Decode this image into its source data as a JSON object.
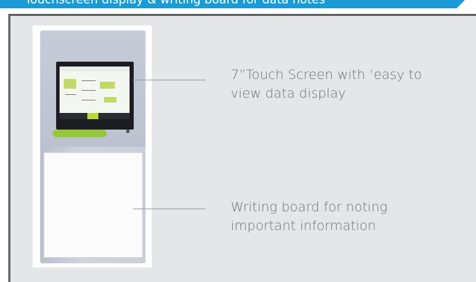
{
  "header": {
    "title": "Touchscreen display & writing board for data notes"
  },
  "callouts": {
    "touch_screen": {
      "line1": "7”Touch Screen with ‘easy to",
      "line2": "view data display"
    },
    "writing_board": {
      "line1": "Writing board for noting",
      "line2": "important information"
    }
  },
  "colors": {
    "header_bar": "#1a9ad6",
    "panel_background": "#e5e6e8",
    "panel_border": "#5f6163",
    "device_accent_green": "#97c83a",
    "text": "#6e7073"
  }
}
